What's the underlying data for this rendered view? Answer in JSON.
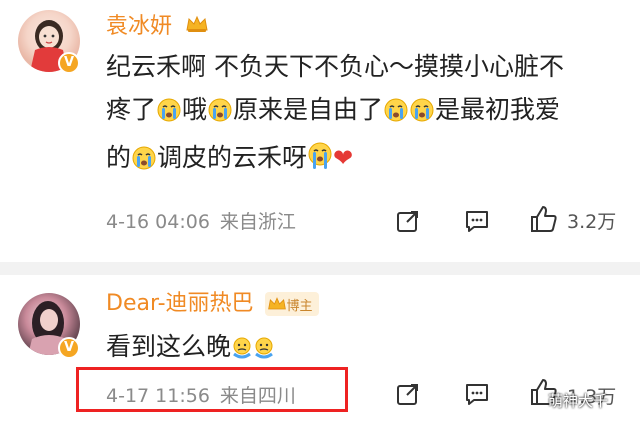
{
  "comments": [
    {
      "author": "袁冰妍",
      "content": {
        "line1": "纪云禾啊 不负天下不负心～摸摸小心脏不",
        "line2a": "疼了",
        "line2b": "哦",
        "line2c": "原来是自由了",
        "line2d": "是最初我爱",
        "line3a": "的",
        "line3b": "调皮的云禾呀"
      },
      "time": "4-16 04:06",
      "source": "来自浙江",
      "likes": "3.2万"
    },
    {
      "author": "Dear-迪丽热巴",
      "badge": "博主",
      "content": {
        "line1": "看到这么晚"
      },
      "time": "4-17 11:56",
      "source": "来自四川",
      "likes": "1.3万"
    }
  ],
  "watermark": "萌神大千",
  "colors": {
    "name": "#f08a24",
    "verified": "#f5a623",
    "highlight": "#e22222",
    "separator": "#f2f2f2"
  },
  "icons": [
    "verified-icon",
    "crown-icon",
    "crying-emoji-icon",
    "heart-icon",
    "share-icon",
    "comment-icon",
    "like-icon",
    "sweat-emoji-icon"
  ]
}
